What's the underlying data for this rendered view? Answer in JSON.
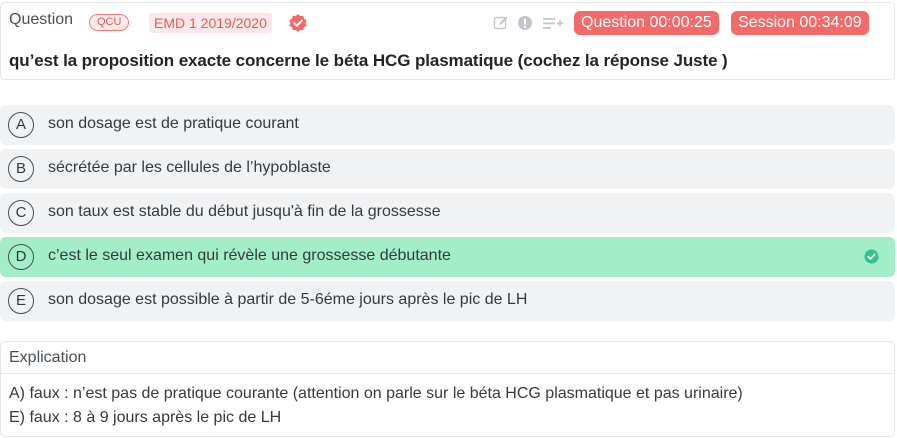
{
  "question": {
    "label": "Question",
    "type_badge": "QCU",
    "source_badge": "EMD 1 2019/2020",
    "verified_icon": "verified-badge-icon",
    "tools": [
      "edit-icon",
      "info-icon",
      "playlist-add-icon"
    ],
    "timer_question": "Question 00:00:25",
    "timer_session": "Session 00:34:09",
    "text": "qu’est la proposition exacte concerne le béta HCG plasmatique (cochez la réponse Juste )"
  },
  "options": [
    {
      "letter": "A",
      "text": "son dosage est de pratique courant",
      "correct": false
    },
    {
      "letter": "B",
      "text": "sécrétée par les cellules de l’hypoblaste",
      "correct": false
    },
    {
      "letter": "C",
      "text": "son taux est stable du début jusqu'à fin de la grossesse",
      "correct": false
    },
    {
      "letter": "D",
      "text": "c’est le seul examen qui révèle une grossesse débutante",
      "correct": true
    },
    {
      "letter": "E",
      "text": "son dosage est possible à partir de 5-6éme jours après le pic de LH",
      "correct": false
    }
  ],
  "explanation": {
    "title": "Explication",
    "lines": [
      "A) faux : n’est pas de pratique courante (attention on parle sur le béta HCG plasmatique et pas urinaire)",
      "E) faux : 8 à 9 jours après le pic de LH"
    ]
  },
  "colors": {
    "accent_red": "#f46a6a",
    "correct_bg": "#a3eec8",
    "correct_check": "#34c38f",
    "option_bg": "#f1f2f4"
  }
}
